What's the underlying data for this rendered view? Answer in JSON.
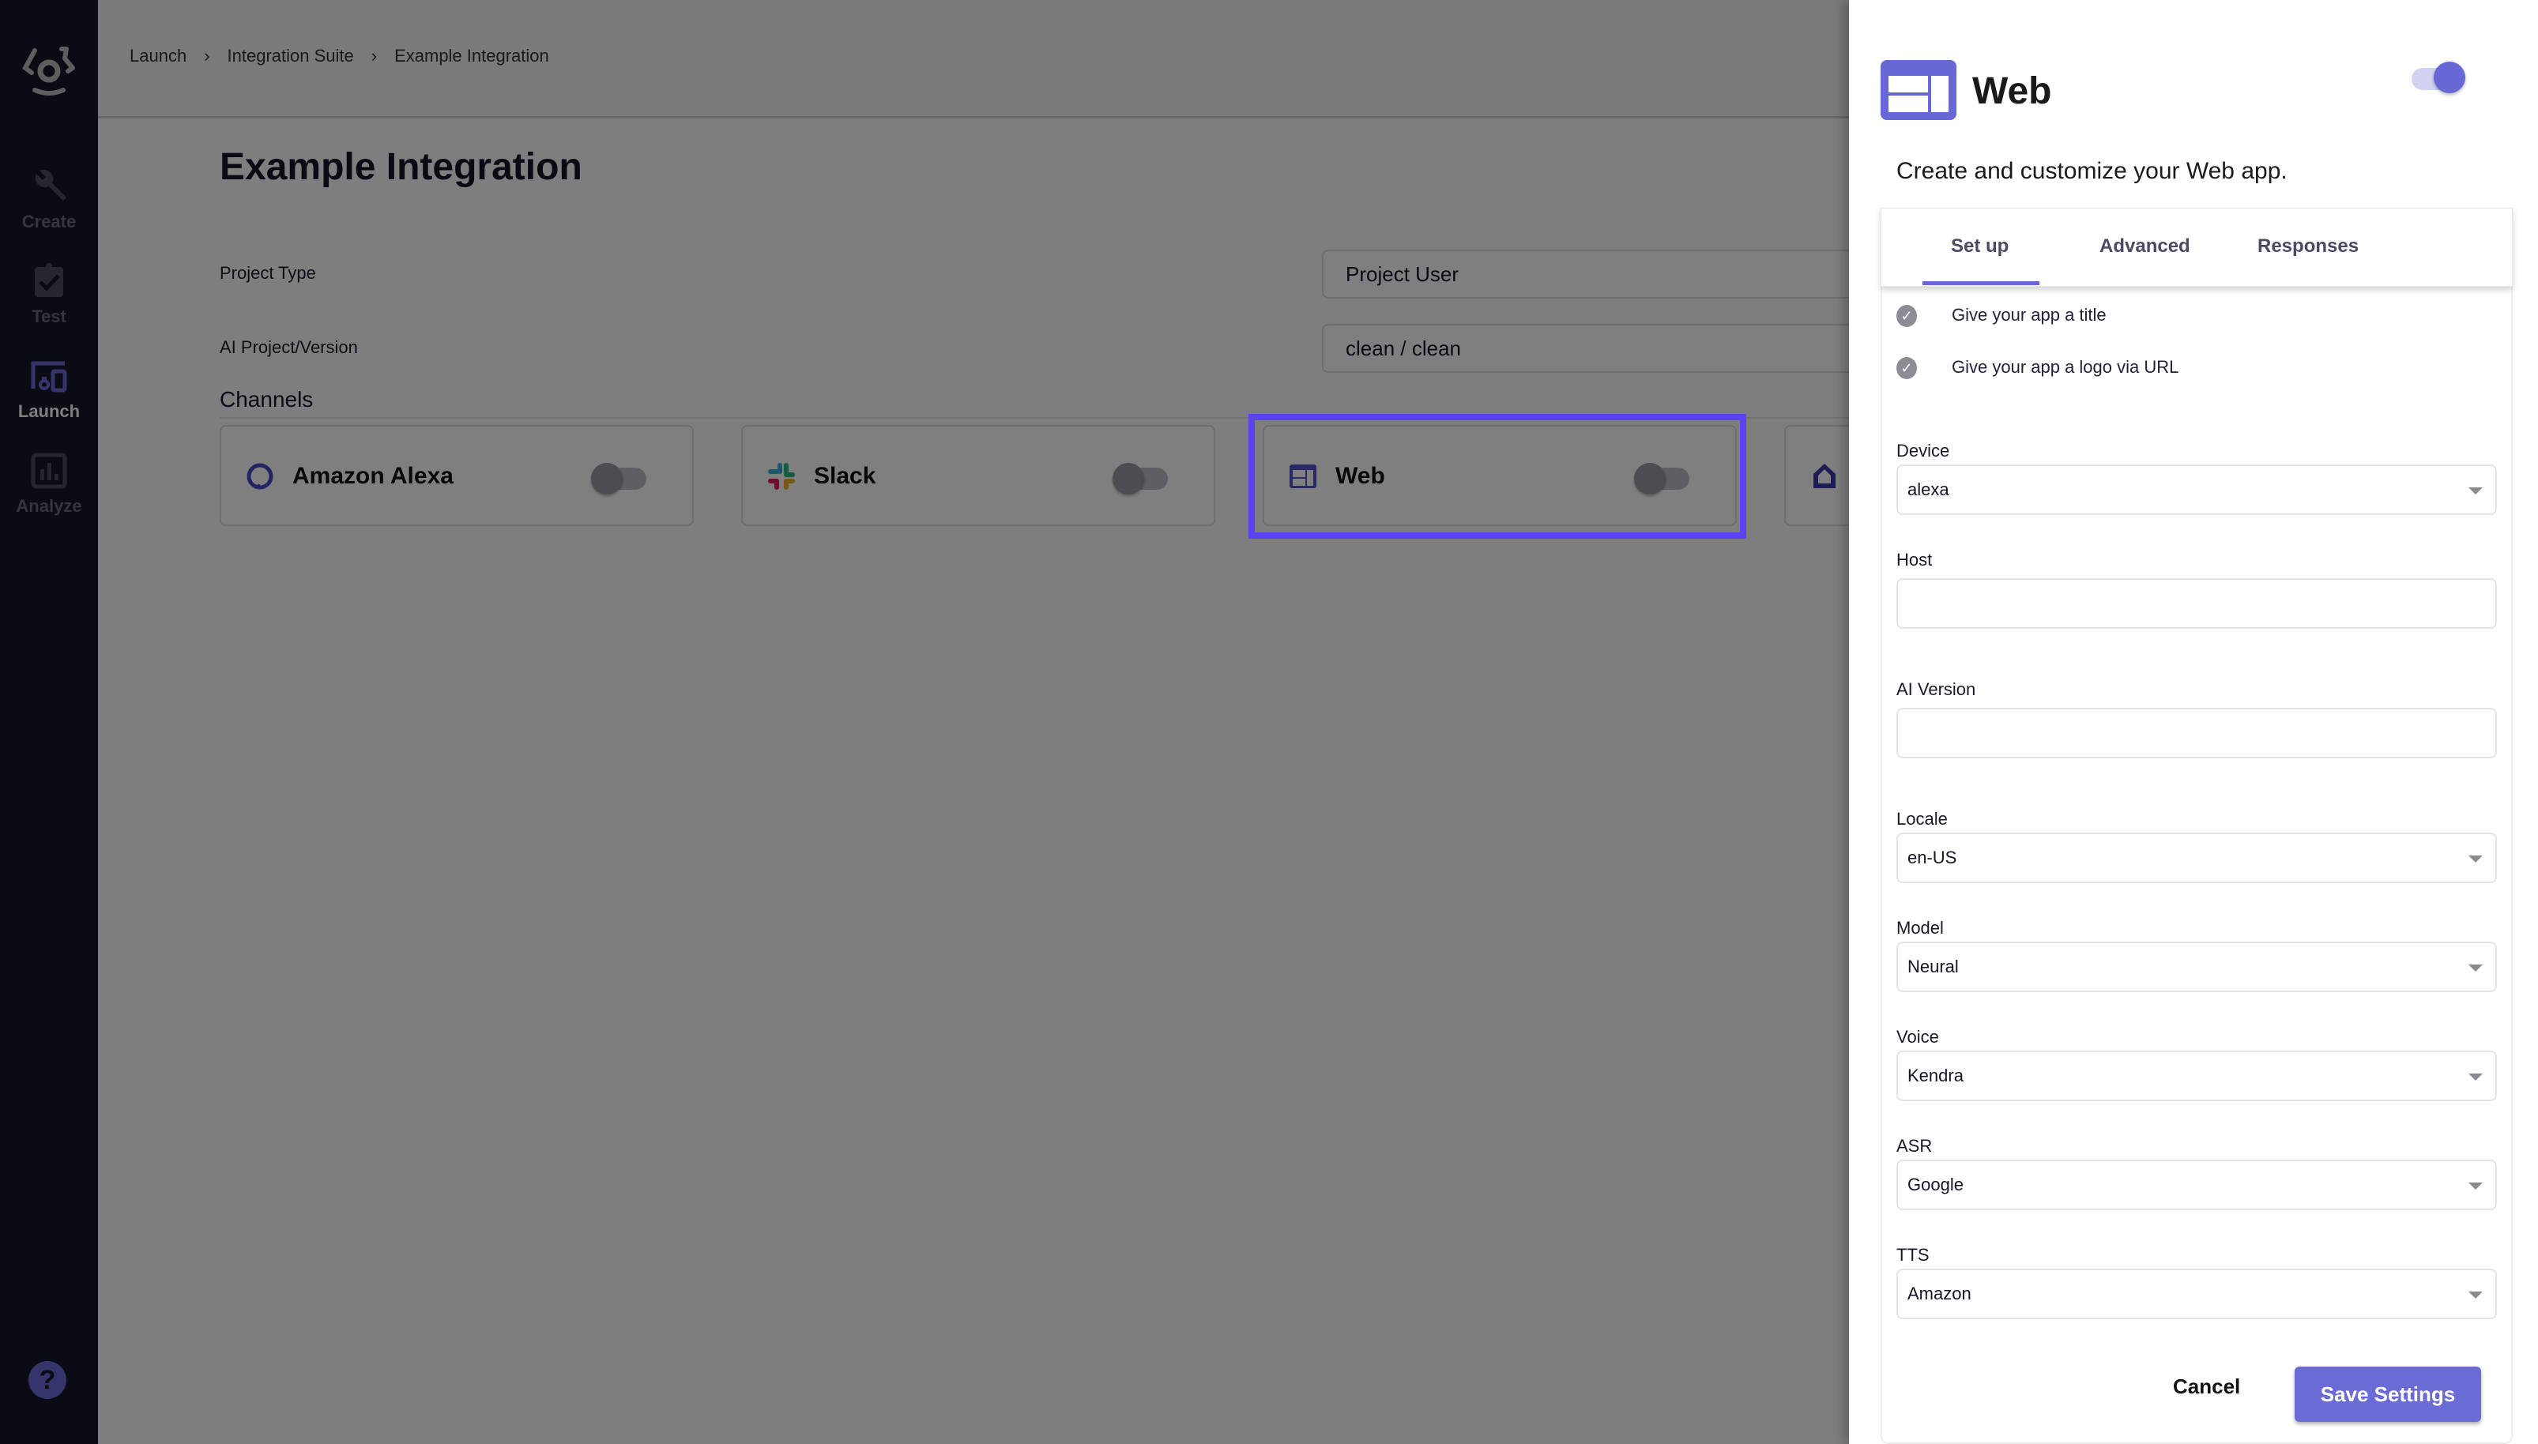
{
  "sidebar": {
    "logo": "voice-bot-logo-icon",
    "items": [
      {
        "label": "Create",
        "icon": "wrench-icon",
        "active": false
      },
      {
        "label": "Test",
        "icon": "clipboard-check-icon",
        "active": false
      },
      {
        "label": "Launch",
        "icon": "devices-icon",
        "active": true
      },
      {
        "label": "Analyze",
        "icon": "bar-chart-icon",
        "active": false
      }
    ],
    "help_label": "?"
  },
  "header": {
    "breadcrumb": [
      "Launch",
      "Integration Suite",
      "Example Integration"
    ]
  },
  "page": {
    "title": "Example Integration",
    "project_type_label": "Project Type",
    "project_type_value": "Project User",
    "ai_project_label": "AI Project/Version",
    "ai_project_value": "clean / clean",
    "channels_title": "Channels",
    "channels": [
      {
        "name": "Amazon Alexa",
        "icon": "alexa-ring-icon",
        "enabled": false
      },
      {
        "name": "Slack",
        "icon": "slack-icon",
        "enabled": false
      },
      {
        "name": "Web",
        "icon": "web-layout-icon",
        "enabled": false,
        "highlighted": true
      },
      {
        "name": "",
        "icon": "home-icon",
        "enabled": false
      }
    ]
  },
  "drawer": {
    "title": "Web",
    "icon": "web-layout-icon",
    "enabled": true,
    "subtitle": "Create and customize your Web app.",
    "tabs": [
      {
        "label": "Set up",
        "active": true
      },
      {
        "label": "Advanced",
        "active": false
      },
      {
        "label": "Responses",
        "active": false
      }
    ],
    "checklist": [
      {
        "label": "Give your app a title",
        "done": true
      },
      {
        "label": "Give your app a logo via URL",
        "done": true
      }
    ],
    "fields": {
      "device": {
        "label": "Device",
        "value": "alexa"
      },
      "host": {
        "label": "Host",
        "value": ""
      },
      "ai_version": {
        "label": "AI Version",
        "value": ""
      },
      "locale": {
        "label": "Locale",
        "value": "en-US"
      },
      "model": {
        "label": "Model",
        "value": "Neural"
      },
      "voice": {
        "label": "Voice",
        "value": "Kendra"
      },
      "asr": {
        "label": "ASR",
        "value": "Google"
      },
      "tts": {
        "label": "TTS",
        "value": "Amazon"
      }
    },
    "cancel_label": "Cancel",
    "save_label": "Save Settings"
  },
  "colors": {
    "accent": "#6b6bd6",
    "highlight": "#5b42f3",
    "sidebar_bg": "#141629"
  }
}
